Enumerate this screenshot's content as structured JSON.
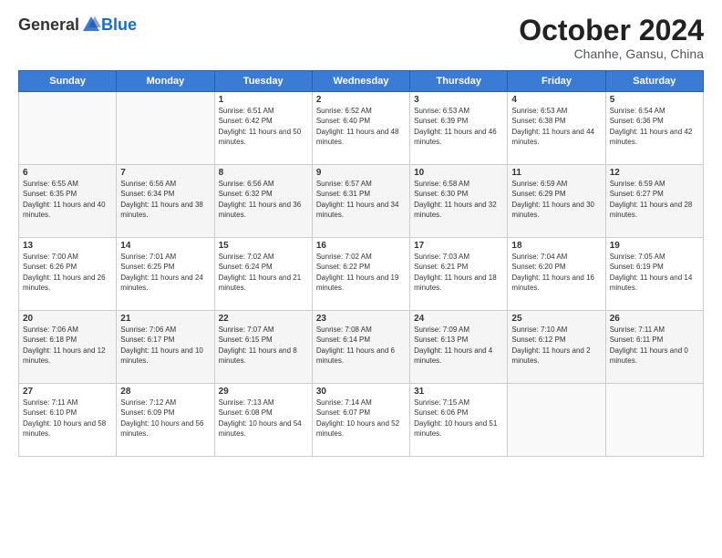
{
  "header": {
    "logo_general": "General",
    "logo_blue": "Blue",
    "month_title": "October 2024",
    "location": "Chanhe, Gansu, China"
  },
  "weekdays": [
    "Sunday",
    "Monday",
    "Tuesday",
    "Wednesday",
    "Thursday",
    "Friday",
    "Saturday"
  ],
  "weeks": [
    [
      {
        "day": "",
        "sunrise": "",
        "sunset": "",
        "daylight": ""
      },
      {
        "day": "",
        "sunrise": "",
        "sunset": "",
        "daylight": ""
      },
      {
        "day": "1",
        "sunrise": "Sunrise: 6:51 AM",
        "sunset": "Sunset: 6:42 PM",
        "daylight": "Daylight: 11 hours and 50 minutes."
      },
      {
        "day": "2",
        "sunrise": "Sunrise: 6:52 AM",
        "sunset": "Sunset: 6:40 PM",
        "daylight": "Daylight: 11 hours and 48 minutes."
      },
      {
        "day": "3",
        "sunrise": "Sunrise: 6:53 AM",
        "sunset": "Sunset: 6:39 PM",
        "daylight": "Daylight: 11 hours and 46 minutes."
      },
      {
        "day": "4",
        "sunrise": "Sunrise: 6:53 AM",
        "sunset": "Sunset: 6:38 PM",
        "daylight": "Daylight: 11 hours and 44 minutes."
      },
      {
        "day": "5",
        "sunrise": "Sunrise: 6:54 AM",
        "sunset": "Sunset: 6:36 PM",
        "daylight": "Daylight: 11 hours and 42 minutes."
      }
    ],
    [
      {
        "day": "6",
        "sunrise": "Sunrise: 6:55 AM",
        "sunset": "Sunset: 6:35 PM",
        "daylight": "Daylight: 11 hours and 40 minutes."
      },
      {
        "day": "7",
        "sunrise": "Sunrise: 6:56 AM",
        "sunset": "Sunset: 6:34 PM",
        "daylight": "Daylight: 11 hours and 38 minutes."
      },
      {
        "day": "8",
        "sunrise": "Sunrise: 6:56 AM",
        "sunset": "Sunset: 6:32 PM",
        "daylight": "Daylight: 11 hours and 36 minutes."
      },
      {
        "day": "9",
        "sunrise": "Sunrise: 6:57 AM",
        "sunset": "Sunset: 6:31 PM",
        "daylight": "Daylight: 11 hours and 34 minutes."
      },
      {
        "day": "10",
        "sunrise": "Sunrise: 6:58 AM",
        "sunset": "Sunset: 6:30 PM",
        "daylight": "Daylight: 11 hours and 32 minutes."
      },
      {
        "day": "11",
        "sunrise": "Sunrise: 6:59 AM",
        "sunset": "Sunset: 6:29 PM",
        "daylight": "Daylight: 11 hours and 30 minutes."
      },
      {
        "day": "12",
        "sunrise": "Sunrise: 6:59 AM",
        "sunset": "Sunset: 6:27 PM",
        "daylight": "Daylight: 11 hours and 28 minutes."
      }
    ],
    [
      {
        "day": "13",
        "sunrise": "Sunrise: 7:00 AM",
        "sunset": "Sunset: 6:26 PM",
        "daylight": "Daylight: 11 hours and 26 minutes."
      },
      {
        "day": "14",
        "sunrise": "Sunrise: 7:01 AM",
        "sunset": "Sunset: 6:25 PM",
        "daylight": "Daylight: 11 hours and 24 minutes."
      },
      {
        "day": "15",
        "sunrise": "Sunrise: 7:02 AM",
        "sunset": "Sunset: 6:24 PM",
        "daylight": "Daylight: 11 hours and 21 minutes."
      },
      {
        "day": "16",
        "sunrise": "Sunrise: 7:02 AM",
        "sunset": "Sunset: 6:22 PM",
        "daylight": "Daylight: 11 hours and 19 minutes."
      },
      {
        "day": "17",
        "sunrise": "Sunrise: 7:03 AM",
        "sunset": "Sunset: 6:21 PM",
        "daylight": "Daylight: 11 hours and 18 minutes."
      },
      {
        "day": "18",
        "sunrise": "Sunrise: 7:04 AM",
        "sunset": "Sunset: 6:20 PM",
        "daylight": "Daylight: 11 hours and 16 minutes."
      },
      {
        "day": "19",
        "sunrise": "Sunrise: 7:05 AM",
        "sunset": "Sunset: 6:19 PM",
        "daylight": "Daylight: 11 hours and 14 minutes."
      }
    ],
    [
      {
        "day": "20",
        "sunrise": "Sunrise: 7:06 AM",
        "sunset": "Sunset: 6:18 PM",
        "daylight": "Daylight: 11 hours and 12 minutes."
      },
      {
        "day": "21",
        "sunrise": "Sunrise: 7:06 AM",
        "sunset": "Sunset: 6:17 PM",
        "daylight": "Daylight: 11 hours and 10 minutes."
      },
      {
        "day": "22",
        "sunrise": "Sunrise: 7:07 AM",
        "sunset": "Sunset: 6:15 PM",
        "daylight": "Daylight: 11 hours and 8 minutes."
      },
      {
        "day": "23",
        "sunrise": "Sunrise: 7:08 AM",
        "sunset": "Sunset: 6:14 PM",
        "daylight": "Daylight: 11 hours and 6 minutes."
      },
      {
        "day": "24",
        "sunrise": "Sunrise: 7:09 AM",
        "sunset": "Sunset: 6:13 PM",
        "daylight": "Daylight: 11 hours and 4 minutes."
      },
      {
        "day": "25",
        "sunrise": "Sunrise: 7:10 AM",
        "sunset": "Sunset: 6:12 PM",
        "daylight": "Daylight: 11 hours and 2 minutes."
      },
      {
        "day": "26",
        "sunrise": "Sunrise: 7:11 AM",
        "sunset": "Sunset: 6:11 PM",
        "daylight": "Daylight: 11 hours and 0 minutes."
      }
    ],
    [
      {
        "day": "27",
        "sunrise": "Sunrise: 7:11 AM",
        "sunset": "Sunset: 6:10 PM",
        "daylight": "Daylight: 10 hours and 58 minutes."
      },
      {
        "day": "28",
        "sunrise": "Sunrise: 7:12 AM",
        "sunset": "Sunset: 6:09 PM",
        "daylight": "Daylight: 10 hours and 56 minutes."
      },
      {
        "day": "29",
        "sunrise": "Sunrise: 7:13 AM",
        "sunset": "Sunset: 6:08 PM",
        "daylight": "Daylight: 10 hours and 54 minutes."
      },
      {
        "day": "30",
        "sunrise": "Sunrise: 7:14 AM",
        "sunset": "Sunset: 6:07 PM",
        "daylight": "Daylight: 10 hours and 52 minutes."
      },
      {
        "day": "31",
        "sunrise": "Sunrise: 7:15 AM",
        "sunset": "Sunset: 6:06 PM",
        "daylight": "Daylight: 10 hours and 51 minutes."
      },
      {
        "day": "",
        "sunrise": "",
        "sunset": "",
        "daylight": ""
      },
      {
        "day": "",
        "sunrise": "",
        "sunset": "",
        "daylight": ""
      }
    ]
  ]
}
